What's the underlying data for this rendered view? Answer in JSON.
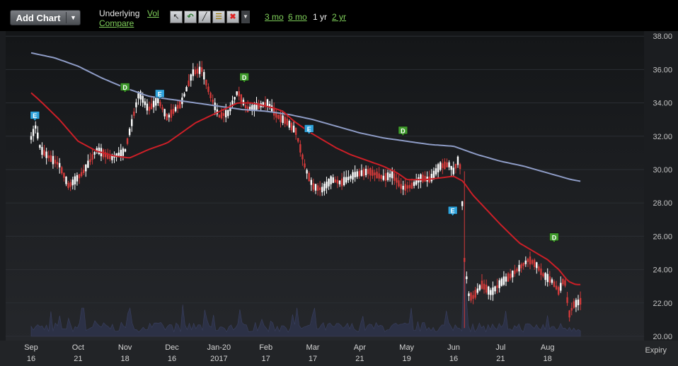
{
  "toolbar": {
    "add_chart_label": "Add Chart",
    "underlying_label": "Underlying",
    "vol_link": "Vol",
    "compare_link": "Compare",
    "periods": [
      {
        "label": "3 mo",
        "active": false
      },
      {
        "label": "6 mo",
        "active": false
      },
      {
        "label": "1 yr",
        "active": true
      },
      {
        "label": "2 yr",
        "active": false
      }
    ],
    "tools": [
      "cursor-icon",
      "undo-icon",
      "line-draw-icon",
      "indicator-icon",
      "delete-icon",
      "dropdown-icon"
    ]
  },
  "axis": {
    "expiry_label": "Expiry"
  },
  "colors": {
    "up_candle": "#ffffff",
    "down_candle": "#d23a3a",
    "ma_short": "#cc1f27",
    "ma_long": "#8e9cc6",
    "volume": "#2c3146",
    "earnings_marker": "#2fa3dc",
    "dividend_marker": "#3f9a2c"
  },
  "chart_data": {
    "type": "candlestick",
    "ylim": [
      20,
      38
    ],
    "yticks": [
      "38.00",
      "36.00",
      "34.00",
      "32.00",
      "30.00",
      "28.00",
      "26.00",
      "24.00",
      "22.00",
      "20.00"
    ],
    "xticks": [
      {
        "top": "Sep",
        "bottom": "16",
        "t": 0.0
      },
      {
        "top": "Oct",
        "bottom": "21",
        "t": 0.5
      },
      {
        "top": "Nov",
        "bottom": "18",
        "t": 1.0
      },
      {
        "top": "Dec",
        "bottom": "16",
        "t": 1.5
      },
      {
        "top": "Jan-20",
        "bottom": "2017",
        "t": 2.0
      },
      {
        "top": "Feb",
        "bottom": "17",
        "t": 2.5
      },
      {
        "top": "Mar",
        "bottom": "17",
        "t": 3.0
      },
      {
        "top": "Apr",
        "bottom": "21",
        "t": 3.5
      },
      {
        "top": "May",
        "bottom": "19",
        "t": 4.0
      },
      {
        "top": "Jun",
        "bottom": "16",
        "t": 4.5
      },
      {
        "top": "Jul",
        "bottom": "21",
        "t": 5.0
      },
      {
        "top": "Aug",
        "bottom": "18",
        "t": 5.5
      }
    ],
    "price_keypoints": [
      [
        0,
        31.9
      ],
      [
        0.05,
        32.6
      ],
      [
        0.1,
        31.2
      ],
      [
        0.2,
        30.7
      ],
      [
        0.3,
        30.3
      ],
      [
        0.4,
        29.0
      ],
      [
        0.55,
        29.8
      ],
      [
        0.7,
        31.2
      ],
      [
        0.85,
        30.7
      ],
      [
        1.0,
        31.1
      ],
      [
        1.08,
        33.0
      ],
      [
        1.15,
        34.6
      ],
      [
        1.25,
        33.6
      ],
      [
        1.35,
        34.2
      ],
      [
        1.45,
        33.1
      ],
      [
        1.6,
        34.0
      ],
      [
        1.72,
        35.8
      ],
      [
        1.82,
        36.0
      ],
      [
        1.9,
        34.6
      ],
      [
        2.0,
        33.2
      ],
      [
        2.1,
        33.4
      ],
      [
        2.2,
        34.7
      ],
      [
        2.3,
        33.6
      ],
      [
        2.42,
        33.8
      ],
      [
        2.52,
        34.0
      ],
      [
        2.62,
        33.2
      ],
      [
        2.72,
        32.9
      ],
      [
        2.82,
        32.3
      ],
      [
        2.92,
        30.1
      ],
      [
        3.0,
        29.0
      ],
      [
        3.1,
        28.8
      ],
      [
        3.2,
        29.4
      ],
      [
        3.3,
        29.2
      ],
      [
        3.45,
        29.7
      ],
      [
        3.6,
        29.9
      ],
      [
        3.75,
        29.5
      ],
      [
        3.85,
        29.7
      ],
      [
        3.95,
        28.9
      ],
      [
        4.05,
        29.0
      ],
      [
        4.15,
        29.5
      ],
      [
        4.25,
        29.4
      ],
      [
        4.35,
        30.2
      ],
      [
        4.45,
        30.3
      ],
      [
        4.5,
        29.9
      ],
      [
        4.55,
        30.6
      ],
      [
        4.58,
        29.9
      ],
      [
        4.61,
        24.8
      ],
      [
        4.66,
        22.5
      ],
      [
        4.7,
        22.3
      ],
      [
        4.8,
        23.1
      ],
      [
        4.9,
        22.6
      ],
      [
        5.0,
        23.2
      ],
      [
        5.1,
        23.6
      ],
      [
        5.2,
        24.1
      ],
      [
        5.3,
        24.6
      ],
      [
        5.38,
        24.3
      ],
      [
        5.45,
        23.7
      ],
      [
        5.55,
        23.3
      ],
      [
        5.62,
        22.7
      ],
      [
        5.68,
        23.5
      ],
      [
        5.73,
        21.3
      ],
      [
        5.78,
        21.9
      ],
      [
        5.85,
        22.1
      ]
    ],
    "ma_short_keypoints": [
      [
        0,
        34.6
      ],
      [
        0.1,
        34.1
      ],
      [
        0.3,
        33.0
      ],
      [
        0.5,
        31.7
      ],
      [
        0.7,
        31.1
      ],
      [
        0.9,
        30.8
      ],
      [
        1.05,
        30.7
      ],
      [
        1.25,
        31.2
      ],
      [
        1.45,
        31.6
      ],
      [
        1.6,
        32.2
      ],
      [
        1.75,
        32.8
      ],
      [
        1.9,
        33.2
      ],
      [
        2.05,
        33.6
      ],
      [
        2.2,
        34.0
      ],
      [
        2.35,
        34.0
      ],
      [
        2.5,
        33.8
      ],
      [
        2.58,
        33.7
      ],
      [
        2.68,
        33.5
      ],
      [
        2.8,
        32.9
      ],
      [
        2.95,
        32.3
      ],
      [
        3.1,
        31.8
      ],
      [
        3.25,
        31.3
      ],
      [
        3.4,
        30.9
      ],
      [
        3.6,
        30.5
      ],
      [
        3.75,
        30.2
      ],
      [
        3.9,
        29.8
      ],
      [
        4.0,
        29.4
      ],
      [
        4.2,
        29.4
      ],
      [
        4.35,
        29.5
      ],
      [
        4.5,
        29.6
      ],
      [
        4.6,
        29.3
      ],
      [
        4.7,
        28.5
      ],
      [
        4.85,
        27.6
      ],
      [
        5.0,
        26.7
      ],
      [
        5.2,
        25.6
      ],
      [
        5.35,
        25.1
      ],
      [
        5.5,
        24.6
      ],
      [
        5.62,
        24.0
      ],
      [
        5.72,
        23.3
      ],
      [
        5.8,
        23.1
      ],
      [
        5.85,
        23.1
      ]
    ],
    "ma_long_keypoints": [
      [
        0,
        37.0
      ],
      [
        0.25,
        36.7
      ],
      [
        0.5,
        36.2
      ],
      [
        0.75,
        35.5
      ],
      [
        1.0,
        34.9
      ],
      [
        1.25,
        34.4
      ],
      [
        1.5,
        34.2
      ],
      [
        1.75,
        34.0
      ],
      [
        2.0,
        33.8
      ],
      [
        2.25,
        33.6
      ],
      [
        2.5,
        33.5
      ],
      [
        2.75,
        33.3
      ],
      [
        3.0,
        33.0
      ],
      [
        3.25,
        32.6
      ],
      [
        3.5,
        32.2
      ],
      [
        3.75,
        31.9
      ],
      [
        4.0,
        31.7
      ],
      [
        4.25,
        31.5
      ],
      [
        4.5,
        31.4
      ],
      [
        4.75,
        30.9
      ],
      [
        5.0,
        30.5
      ],
      [
        5.25,
        30.2
      ],
      [
        5.5,
        29.8
      ],
      [
        5.75,
        29.4
      ],
      [
        5.85,
        29.3
      ]
    ],
    "markers": [
      {
        "label": "E",
        "kind": "earnings",
        "t": 0.04,
        "price": 32.9
      },
      {
        "label": "D",
        "kind": "dividend",
        "t": 1.0,
        "price": 34.6
      },
      {
        "label": "E",
        "kind": "earnings",
        "t": 1.37,
        "price": 34.2
      },
      {
        "label": "D",
        "kind": "dividend",
        "t": 2.27,
        "price": 35.2
      },
      {
        "label": "E",
        "kind": "earnings",
        "t": 2.96,
        "price": 32.1
      },
      {
        "label": "D",
        "kind": "dividend",
        "t": 3.96,
        "price": 32.0
      },
      {
        "label": "E",
        "kind": "earnings",
        "t": 4.49,
        "price": 27.2
      },
      {
        "label": "D",
        "kind": "dividend",
        "t": 5.57,
        "price": 25.6
      }
    ]
  }
}
